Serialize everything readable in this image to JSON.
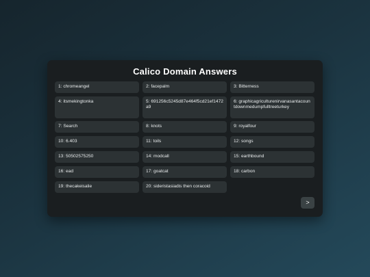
{
  "title": "Calico Domain Answers",
  "answers": [
    "1: chromeangel",
    "2: facepalm",
    "3: Bitterness",
    "4: itsmekingtonka",
    "5: 691256c5245d87e464f5cd21ef1472a9",
    "6: graphicagriculturenirvanasantacountdownmedumpfulltreeturkey",
    "7: Search",
    "8: knots",
    "9: royalfour",
    "10: 6.403",
    "11: toils",
    "12: songs",
    "13: 50502575250",
    "14: modcall",
    "15: earthbound",
    "16: ead",
    "17: goatcat",
    "18: carbon",
    "19: thecakeisalie",
    "20: sideristasiadis then coracoid"
  ],
  "next_label": ">"
}
